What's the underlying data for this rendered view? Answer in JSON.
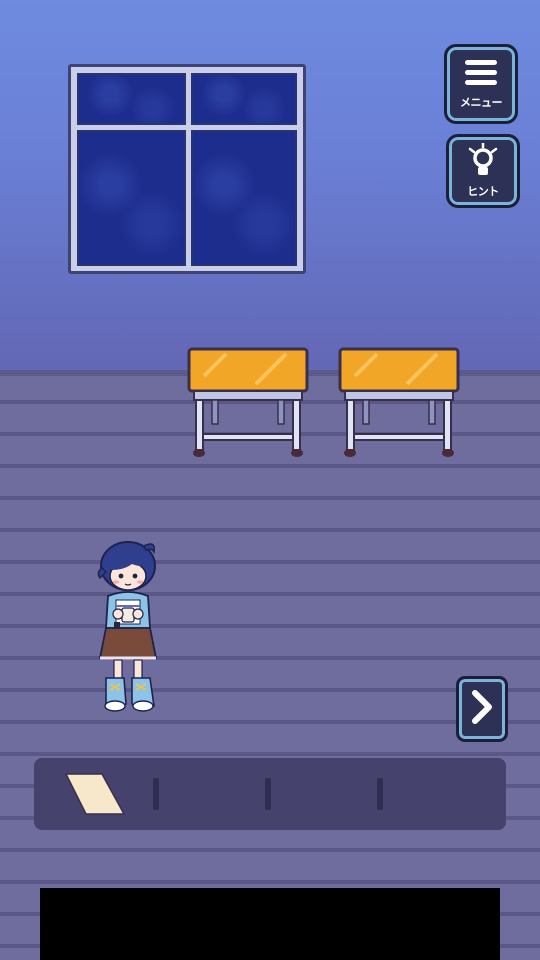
{
  "hud": {
    "menu_label": "メニュー",
    "hint_label": "ヒント"
  },
  "icons": {
    "menu": "hamburger-menu-icon",
    "hint": "lightbulb-icon",
    "next": "chevron-right-icon"
  },
  "inventory": {
    "slots": [
      "paper-note",
      "",
      "",
      ""
    ]
  },
  "colors": {
    "button_fill": "#2e3156",
    "button_outline": "#78b5d8",
    "desk_top": "#f2a628",
    "wall": "#6a80d6"
  }
}
